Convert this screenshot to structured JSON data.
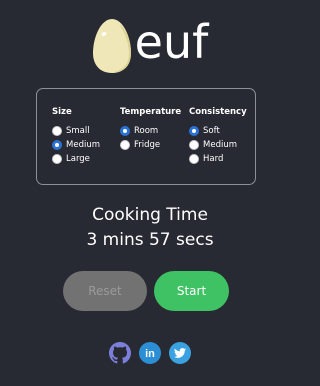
{
  "app": {
    "logo_text": "euf"
  },
  "options": {
    "size": {
      "heading": "Size",
      "items": [
        {
          "label": "Small",
          "checked": false
        },
        {
          "label": "Medium",
          "checked": true
        },
        {
          "label": "Large",
          "checked": false
        }
      ]
    },
    "temperature": {
      "heading": "Temperature",
      "items": [
        {
          "label": "Room",
          "checked": true
        },
        {
          "label": "Fridge",
          "checked": false
        }
      ]
    },
    "consistency": {
      "heading": "Consistency",
      "items": [
        {
          "label": "Soft",
          "checked": true
        },
        {
          "label": "Medium",
          "checked": false
        },
        {
          "label": "Hard",
          "checked": false
        }
      ]
    }
  },
  "cooking": {
    "title": "Cooking Time",
    "time": "3 mins 57 secs"
  },
  "buttons": {
    "reset_label": "Reset",
    "start_label": "Start"
  },
  "social": {
    "icons": [
      "github-icon",
      "linkedin-icon",
      "twitter-icon"
    ]
  },
  "colors": {
    "background": "#282a33",
    "accent_blue": "#2a72d4",
    "start_green": "#3fc263",
    "reset_gray": "#727272"
  }
}
